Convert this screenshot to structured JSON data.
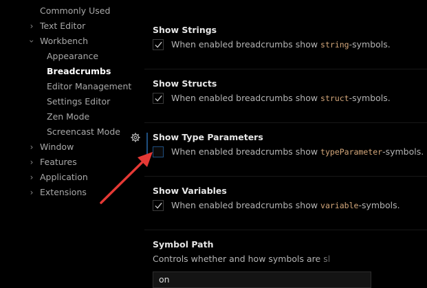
{
  "sidebar": {
    "items": [
      {
        "label": "Commonly Used",
        "chevron": false,
        "expanded": false,
        "level": 0,
        "active": false
      },
      {
        "label": "Text Editor",
        "chevron": true,
        "expanded": false,
        "level": 0,
        "active": false
      },
      {
        "label": "Workbench",
        "chevron": true,
        "expanded": true,
        "level": 0,
        "active": false
      },
      {
        "label": "Appearance",
        "chevron": false,
        "expanded": false,
        "level": 1,
        "active": false
      },
      {
        "label": "Breadcrumbs",
        "chevron": false,
        "expanded": false,
        "level": 1,
        "active": true
      },
      {
        "label": "Editor Management",
        "chevron": false,
        "expanded": false,
        "level": 1,
        "active": false
      },
      {
        "label": "Settings Editor",
        "chevron": false,
        "expanded": false,
        "level": 1,
        "active": false
      },
      {
        "label": "Zen Mode",
        "chevron": false,
        "expanded": false,
        "level": 1,
        "active": false
      },
      {
        "label": "Screencast Mode",
        "chevron": false,
        "expanded": false,
        "level": 1,
        "active": false
      },
      {
        "label": "Window",
        "chevron": true,
        "expanded": false,
        "level": 0,
        "active": false
      },
      {
        "label": "Features",
        "chevron": true,
        "expanded": false,
        "level": 0,
        "active": false
      },
      {
        "label": "Application",
        "chevron": true,
        "expanded": false,
        "level": 0,
        "active": false
      },
      {
        "label": "Extensions",
        "chevron": true,
        "expanded": false,
        "level": 0,
        "active": false
      }
    ]
  },
  "settings": [
    {
      "title": "Show Strings",
      "desc_prefix": "When enabled breadcrumbs show ",
      "desc_code": "string",
      "desc_suffix": "-symbols.",
      "checked": true
    },
    {
      "title": "Show Structs",
      "desc_prefix": "When enabled breadcrumbs show ",
      "desc_code": "struct",
      "desc_suffix": "-symbols.",
      "checked": true
    },
    {
      "title": "Show Type Parameters",
      "desc_prefix": "When enabled breadcrumbs show ",
      "desc_code": "typeParameter",
      "desc_suffix": "-symbols.",
      "checked": false
    },
    {
      "title": "Show Variables",
      "desc_prefix": "When enabled breadcrumbs show ",
      "desc_code": "variable",
      "desc_suffix": "-symbols.",
      "checked": true
    }
  ],
  "symbol_path": {
    "title": "Symbol Path",
    "description": "Controls whether and how symbols are sl",
    "selected": "on"
  },
  "icons": {
    "gear": "gear-icon",
    "check": "check-icon",
    "chevron_right": "chevron-right-icon",
    "chevron_down": "chevron-down-icon",
    "annotation_arrow": "red-arrow-annotation"
  },
  "colors": {
    "background": "#000000",
    "checkbox_focus": "#1f4f80",
    "code_text": "#d4a77a",
    "arrow": "#e53935"
  }
}
